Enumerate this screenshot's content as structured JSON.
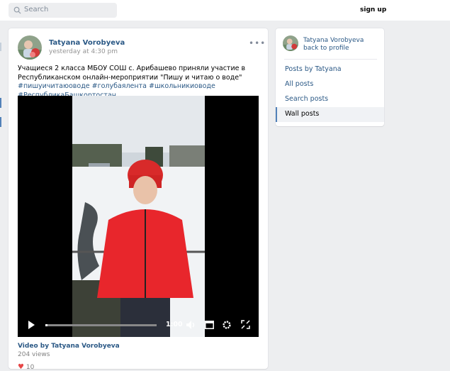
{
  "header": {
    "search_placeholder": "Search",
    "signup_label": "sign up"
  },
  "post": {
    "author": "Tatyana Vorobyeva",
    "time": "yesterday at 4:30 pm",
    "more_icon": "more-icon",
    "text": "Учащиеся 2 класса МБОУ СОШ с. Арибашево приняли участие в Республиканском онлайн-мероприятии \"Пишу и читаю о воде\"",
    "hashtags": "#пишуичитаюоводе #голубаялента #школьникиоводе #РеспубликаБашкортостан",
    "video": {
      "time": "1:00",
      "progress": 0.02,
      "title": "Video by Tatyana Vorobyeva",
      "views": "204 views"
    },
    "likes": "10"
  },
  "sidebar": {
    "name": "Tatyana Vorobyeva",
    "back_label": "back to profile",
    "items": [
      {
        "label": "Posts by Tatyana"
      },
      {
        "label": "All posts"
      },
      {
        "label": "Search posts"
      },
      {
        "label": "Wall posts"
      }
    ],
    "active_index": 3
  },
  "colors": {
    "link": "#2a5885",
    "accent": "#5181b8",
    "background": "#edeef0",
    "jacket": "#e8262c"
  }
}
